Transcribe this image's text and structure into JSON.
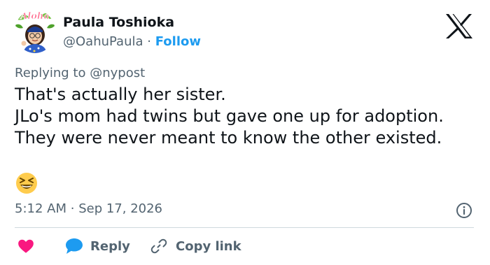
{
  "author": {
    "name": "Paula Toshioka",
    "handle": "@OahuPaula",
    "separator": "·",
    "follow_label": "Follow",
    "avatar_icon": "aloha-cartoon-avatar",
    "avatar_text": "Aloha"
  },
  "brand": {
    "logo_icon": "x-logo-icon"
  },
  "reply_context": {
    "prefix": "Replying to",
    "mention": "@nypost"
  },
  "tweet": {
    "lines": [
      "That's actually her sister.",
      "JLo's mom had twins but gave one up for adoption.",
      "They were never meant to know the other existed."
    ],
    "emoji": "grinning-squinting-face-emoji"
  },
  "meta": {
    "time": "5:12 AM",
    "separator": "·",
    "date": "Sep 17, 2026",
    "info_icon": "info-icon"
  },
  "actions": {
    "like_icon": "heart-icon",
    "reply_icon": "reply-bubble-icon",
    "reply_label": "Reply",
    "copy_icon": "link-icon",
    "copy_label": "Copy link"
  },
  "colors": {
    "accent": "#1d9bf0",
    "like": "#f91880",
    "text": "#0f1419",
    "muted": "#536471",
    "divider": "#cfd9de"
  }
}
